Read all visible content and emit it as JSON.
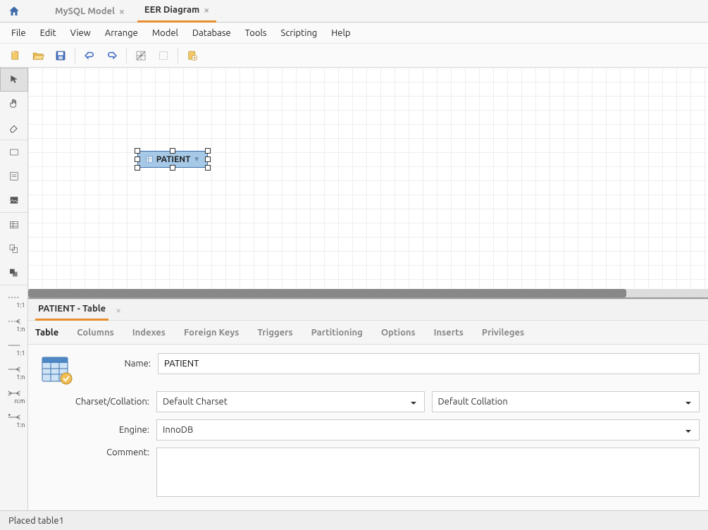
{
  "top_tabs": [
    {
      "label": "MySQL Model",
      "active": false
    },
    {
      "label": "EER Diagram",
      "active": true
    }
  ],
  "menu": [
    "File",
    "Edit",
    "View",
    "Arrange",
    "Model",
    "Database",
    "Tools",
    "Scripting",
    "Help"
  ],
  "entity": {
    "name": "PATIENT"
  },
  "panel": {
    "title": "PATIENT - Table",
    "tabs": [
      "Table",
      "Columns",
      "Indexes",
      "Foreign Keys",
      "Triggers",
      "Partitioning",
      "Options",
      "Inserts",
      "Privileges"
    ],
    "active_tab": "Table",
    "name_label": "Name:",
    "name_value": "PATIENT",
    "charset_label": "Charset/Collation:",
    "charset_value": "Default Charset",
    "collation_value": "Default Collation",
    "engine_label": "Engine:",
    "engine_value": "InnoDB",
    "comment_label": "Comment:",
    "comment_value": ""
  },
  "palette_labels": {
    "rel_11_a": "1:1",
    "rel_1n_a": "1:n",
    "rel_11_b": "1:1",
    "rel_1n_b": "1:n",
    "rel_nm": "n:m",
    "rel_1n_c": "1:n"
  },
  "status": "Placed table1"
}
